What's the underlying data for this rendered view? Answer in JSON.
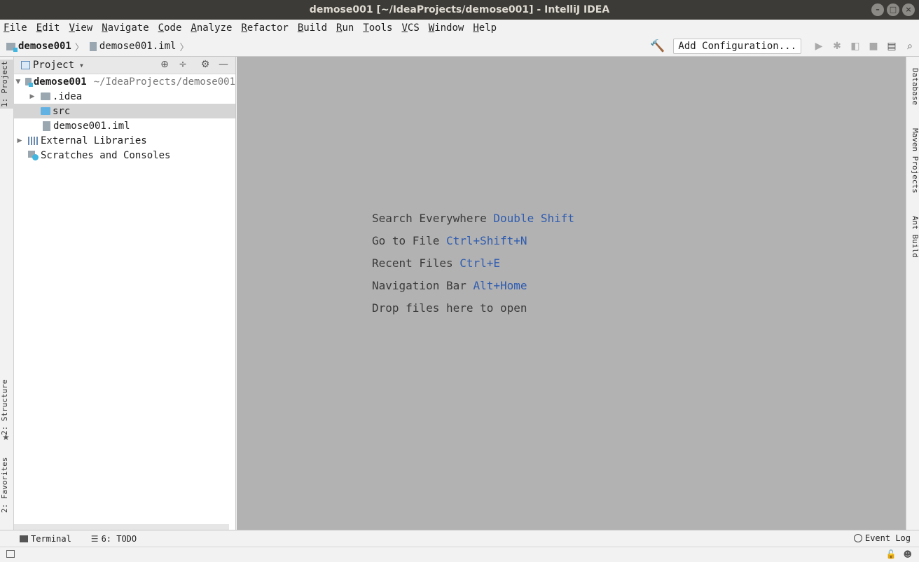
{
  "window": {
    "title": "demose001 [~/IdeaProjects/demose001] - IntelliJ IDEA",
    "controls": [
      "–",
      "□",
      "×"
    ]
  },
  "menu": [
    "File",
    "Edit",
    "View",
    "Navigate",
    "Code",
    "Analyze",
    "Refactor",
    "Build",
    "Run",
    "Tools",
    "VCS",
    "Window",
    "Help"
  ],
  "navbar": {
    "crumbs": [
      "demose001",
      "demose001.iml"
    ],
    "add_configuration": "Add Configuration..."
  },
  "left_strip": {
    "project_tab": "1: Project",
    "structure_tab": "2: Structure",
    "favorites_tab": "2: Favorites"
  },
  "project_panel": {
    "title": "Project",
    "tree": {
      "root_name": "demose001",
      "root_path": "~/IdeaProjects/demose001",
      "idea_folder": ".idea",
      "src_folder": "src",
      "iml_file": "demose001.iml",
      "external_libraries": "External Libraries",
      "scratches": "Scratches and Consoles"
    }
  },
  "editor": {
    "hints": [
      {
        "label": "Search Everywhere",
        "shortcut": "Double Shift"
      },
      {
        "label": "Go to File",
        "shortcut": "Ctrl+Shift+N"
      },
      {
        "label": "Recent Files",
        "shortcut": "Ctrl+E"
      },
      {
        "label": "Navigation Bar",
        "shortcut": "Alt+Home"
      },
      {
        "label": "Drop files here to open",
        "shortcut": ""
      }
    ]
  },
  "right_strip": {
    "database_tab": "Database",
    "maven_tab": "Maven Projects",
    "ant_tab": "Ant Build"
  },
  "bottom_bar": {
    "terminal": "Terminal",
    "todo": "6: TODO",
    "event_log": "Event Log"
  },
  "colors": {
    "editor_bg": "#b2b2b2",
    "shortcut": "#2f5cb0",
    "titlebar": "#3c3b37"
  }
}
